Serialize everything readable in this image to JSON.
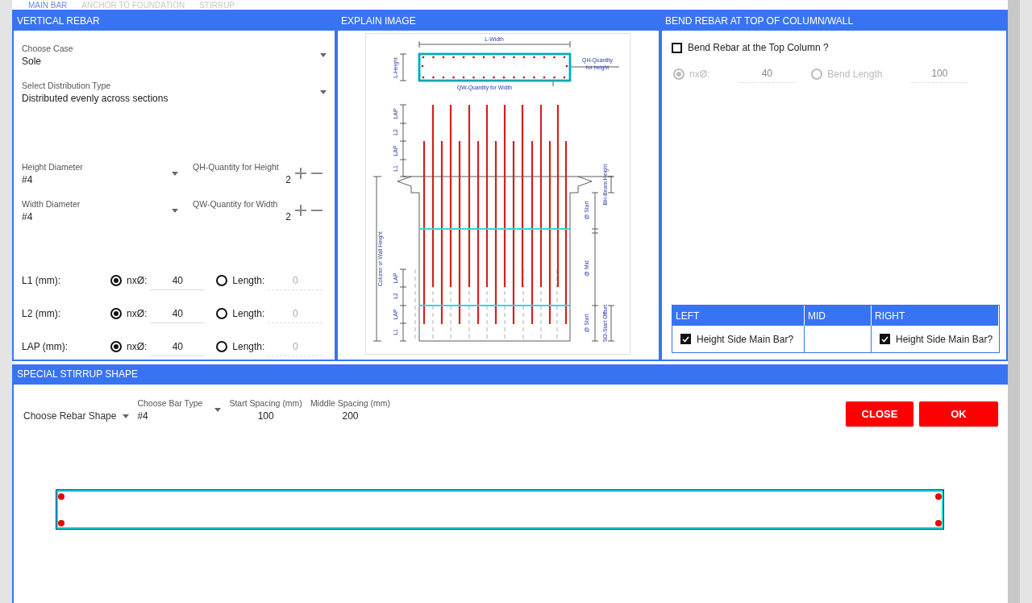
{
  "tabs": [
    {
      "label": "MAIN BAR",
      "selected": true
    },
    {
      "label": "ANCHOR TO FOUNDATION",
      "selected": false
    },
    {
      "label": "STIRRUP",
      "selected": false
    }
  ],
  "vertical_rebar": {
    "title": "VERTICAL REBAR",
    "combos": [
      {
        "label": "Choose Case",
        "value": "Sole"
      },
      {
        "label": "Select Distribution Type",
        "value": "Distributed evenly across sections"
      }
    ],
    "diameters": [
      {
        "label": "Height Diameter",
        "value": "#4",
        "quantity_label": "QH-Quantity for Height",
        "quantity": "2"
      },
      {
        "label": "Width Diameter",
        "value": "#4",
        "quantity_label": "QW-Quantity for Width",
        "quantity": "2"
      }
    ],
    "lengths": [
      {
        "label": "L1 (mm):",
        "factor_label": "nxØ:",
        "factor": "40",
        "factor_selected": true,
        "length_label": "Length:",
        "length": "0",
        "length_selected": false
      },
      {
        "label": "L2 (mm):",
        "factor_label": "nxØ:",
        "factor": "40",
        "factor_selected": true,
        "length_label": "Length:",
        "length": "0",
        "length_selected": false
      },
      {
        "label": "LAP (mm):",
        "factor_label": "nxØ:",
        "factor": "40",
        "factor_selected": true,
        "length_label": "Length:",
        "length": "0",
        "length_selected": false
      }
    ]
  },
  "explain_image": {
    "title": "EXPLAIN IMAGE",
    "labels": [
      "L-Width",
      "L-Height",
      "QH-Quantity",
      "for height",
      "QW-Quantity for Width",
      "LAP",
      "L2",
      "LAP",
      "L1",
      "Column or Wall Height",
      "BH-Beam Height",
      "@ Start",
      "@ Mid",
      "@ Start",
      "SO-Start Offset",
      "LAP",
      "L2",
      "LAP",
      "L1"
    ]
  },
  "bend_rebar": {
    "title": "BEND REBAR AT TOP OF COLUMN/WALL",
    "checkbox": {
      "label": "Bend Rebar at the Top Column ?",
      "checked": false
    },
    "options": [
      {
        "label": "nxØ:",
        "value": "40",
        "selected": true,
        "disabled": true
      },
      {
        "label": "Bend Length",
        "value": "100",
        "selected": false,
        "disabled": true
      }
    ],
    "table": {
      "columns": [
        "LEFT",
        "MID",
        "RIGHT"
      ],
      "cells": [
        {
          "kind": "checkbox",
          "label": "Height Side Main Bar?",
          "checked": true
        },
        {
          "kind": "empty"
        },
        {
          "kind": "checkbox",
          "label": "Height Side Main Bar?",
          "checked": true
        }
      ]
    }
  },
  "stirrup": {
    "title": "SPECIAL STIRRUP SHAPE",
    "shape": {
      "placeholder": "Choose Rebar Shape"
    },
    "bar_type": {
      "label": "Choose Bar Type",
      "value": "#4"
    },
    "spacings": [
      {
        "label": "Start Spacing (mm)",
        "value": "100"
      },
      {
        "label": "Middle Spacing (mm)",
        "value": "200"
      }
    ]
  },
  "buttons": [
    {
      "label": "CLOSE"
    },
    {
      "label": "OK"
    }
  ]
}
